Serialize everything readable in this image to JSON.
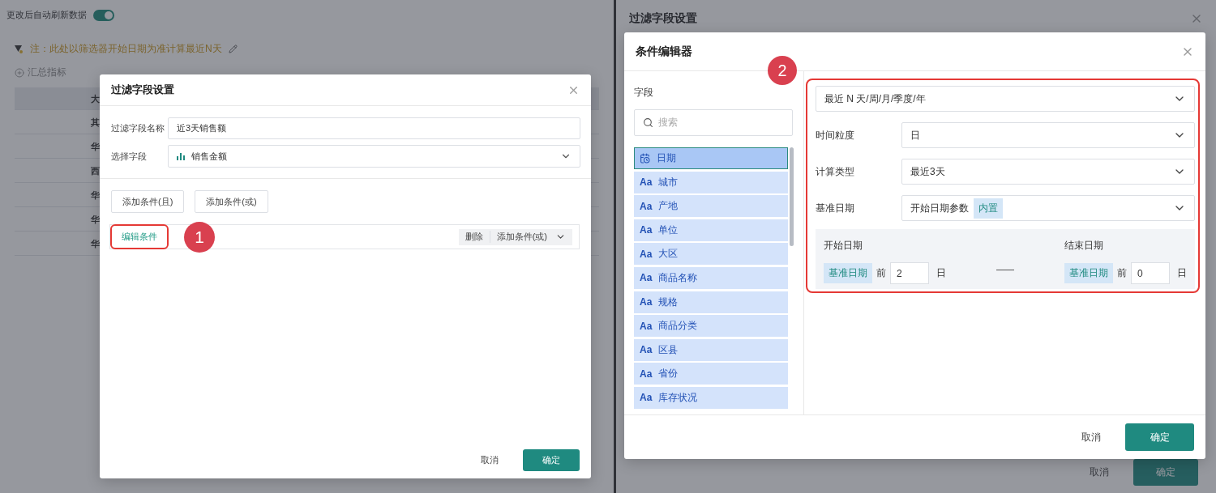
{
  "left": {
    "background": {
      "auto_refresh": {
        "label": "更改后自动刷新数据",
        "on": true
      },
      "note": "注：此处以筛选器开始日期为准计算最近N天",
      "add_metric": "汇总指标",
      "table_cells": [
        "大",
        "其",
        "华",
        "西",
        "华",
        "华",
        "华"
      ]
    },
    "dialog": {
      "title": "过滤字段设置",
      "fields": [
        {
          "kind": "text",
          "label": "过滤字段名称",
          "value": "近3天销售额"
        },
        {
          "kind": "select",
          "label": "选择字段",
          "value": "销售金额"
        }
      ],
      "add_buttons": [
        "添加条件(且)",
        "添加条件(或)"
      ],
      "condition": {
        "edit_link": "编辑条件",
        "marker": "1",
        "delete": "删除",
        "add_or": "添加条件(或)"
      },
      "footer": {
        "cancel": "取消",
        "ok": "确定"
      }
    }
  },
  "right": {
    "background": {
      "title": "过滤字段设置",
      "cancel": "取消",
      "ok": "确定"
    },
    "dialog": {
      "title": "条件编辑器",
      "marker": "2",
      "field_panel": {
        "label": "字段",
        "search_placeholder": "搜索",
        "items": [
          {
            "kind": "date",
            "label": "日期",
            "selected": true
          },
          {
            "kind": "text",
            "icon_text": "Aa",
            "label": "城市",
            "selected": false
          },
          {
            "kind": "text",
            "icon_text": "Aa",
            "label": "产地",
            "selected": false
          },
          {
            "kind": "text",
            "icon_text": "Aa",
            "label": "单位",
            "selected": false
          },
          {
            "kind": "text",
            "icon_text": "Aa",
            "label": "大区",
            "selected": false
          },
          {
            "kind": "text",
            "icon_text": "Aa",
            "label": "商品名称",
            "selected": false
          },
          {
            "kind": "text",
            "icon_text": "Aa",
            "label": "规格",
            "selected": false
          },
          {
            "kind": "text",
            "icon_text": "Aa",
            "label": "商品分类",
            "selected": false
          },
          {
            "kind": "text",
            "icon_text": "Aa",
            "label": "区县",
            "selected": false
          },
          {
            "kind": "text",
            "icon_text": "Aa",
            "label": "省份",
            "selected": false
          },
          {
            "kind": "text",
            "icon_text": "Aa",
            "label": "库存状况",
            "selected": false
          }
        ]
      },
      "mode": "最近 N 天/周/月/季度/年",
      "rows": [
        {
          "label": "时间粒度",
          "value": "日"
        },
        {
          "label": "计算类型",
          "value": "最近3天"
        },
        {
          "label": "基准日期",
          "value": "开始日期参数",
          "tag": "内置"
        }
      ],
      "range": [
        {
          "label": "开始日期",
          "tag": "基准日期",
          "before": "前",
          "value": "2",
          "unit": "日"
        },
        {
          "label": "结束日期",
          "tag": "基准日期",
          "before": "前",
          "value": "0",
          "unit": "日"
        }
      ],
      "footer": {
        "cancel": "取消",
        "ok": "确定"
      }
    }
  }
}
